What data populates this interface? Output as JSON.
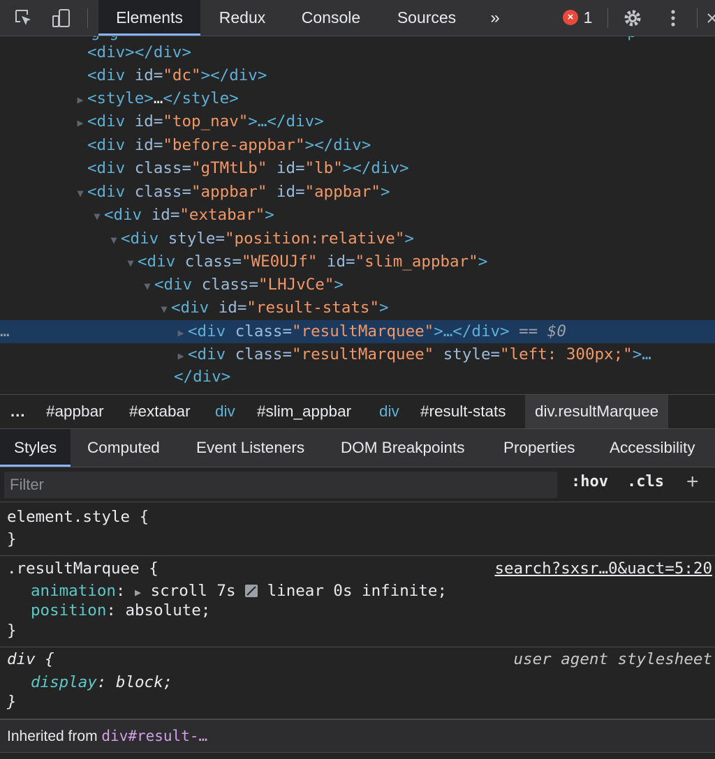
{
  "toolbar": {
    "tabs": [
      "Elements",
      "Redux",
      "Console",
      "Sources"
    ],
    "more": "»",
    "error_count": "1",
    "icons": [
      "inspect-icon",
      "device-toggle-icon",
      "gear-icon",
      "kebab-menu-icon"
    ]
  },
  "tree": {
    "lines": [
      {
        "open": "<div>",
        "close": "</div>"
      },
      {
        "tag": "<div",
        "a1": " id=",
        "v1": "\"dc\"",
        "close": "></div>"
      },
      {
        "tag": "<style>",
        "mid": "…",
        "close": "</style>"
      },
      {
        "tag": "<div",
        "a1": " id=",
        "v1": "\"top_nav\"",
        "close": ">…</div>"
      },
      {
        "tag": "<div",
        "a1": " id=",
        "v1": "\"before-appbar\"",
        "close": "></div>"
      },
      {
        "tag": "<div",
        "a1": " class=",
        "v1": "\"gTMtLb\"",
        "a2": " id=",
        "v2": "\"lb\"",
        "close": "></div>"
      },
      {
        "tag": "<div",
        "a1": " class=",
        "v1": "\"appbar\"",
        "a2": " id=",
        "v2": "\"appbar\"",
        "close": ">"
      },
      {
        "tag": "<div",
        "a1": " id=",
        "v1": "\"extabar\"",
        "close": ">"
      },
      {
        "tag": "<div",
        "a1": " style=",
        "v1": "\"position:relative\"",
        "close": ">"
      },
      {
        "tag": "<div",
        "a1": " class=",
        "v1": "\"WE0UJf\"",
        "a2": " id=",
        "v2": "\"slim_appbar\"",
        "close": ">"
      },
      {
        "tag": "<div",
        "a1": " class=",
        "v1": "\"LHJvCe\"",
        "close": ">"
      },
      {
        "tag": "<div",
        "a1": " id=",
        "v1": "\"result-stats\"",
        "close": ">"
      },
      {
        "tag": "<div",
        "a1": " class=",
        "v1": "\"resultMarquee\"",
        "close": ">…</div>",
        "suffix": " == $0"
      },
      {
        "tag": "<div",
        "a1": " class=",
        "v1": "\"resultMarquee\"",
        "a2": " style=",
        "v2": "\"left: 300px;\"",
        "close": ">…"
      },
      {
        "close": "</div>"
      }
    ],
    "selected_dots": "…"
  },
  "breadcrumbs": [
    "…",
    "#appbar",
    "#extabar",
    "div",
    "#slim_appbar",
    "div",
    "#result-stats",
    "div.resultMarquee"
  ],
  "subtabs": [
    "Styles",
    "Computed",
    "Event Listeners",
    "DOM Breakpoints",
    "Properties",
    "Accessibility"
  ],
  "filter": {
    "placeholder": "Filter",
    "hov": ":hov",
    "cls": ".cls",
    "add": "+"
  },
  "rules": {
    "element_style": {
      "selector": "element.style {",
      "close": "}"
    },
    "marquee": {
      "selector": ".resultMarquee {",
      "source": "search?sxsr…0&uact=5:20",
      "p1": "animation",
      "v1a": "scroll 7s",
      "v1b": "linear 0s infinite;",
      "p2": "position",
      "v2": "absolute;",
      "close": "}"
    },
    "ua": {
      "selector": "div {",
      "source": "user agent stylesheet",
      "p1": "display",
      "v1": "block;",
      "close": "}"
    }
  },
  "inherited": {
    "label": "Inherited from ",
    "target": "div#result-…"
  },
  "colors": {
    "accent": "#8ab4f8",
    "tag": "#5db0d7",
    "value": "#f29766",
    "selected_row": "#1c3a5e"
  }
}
